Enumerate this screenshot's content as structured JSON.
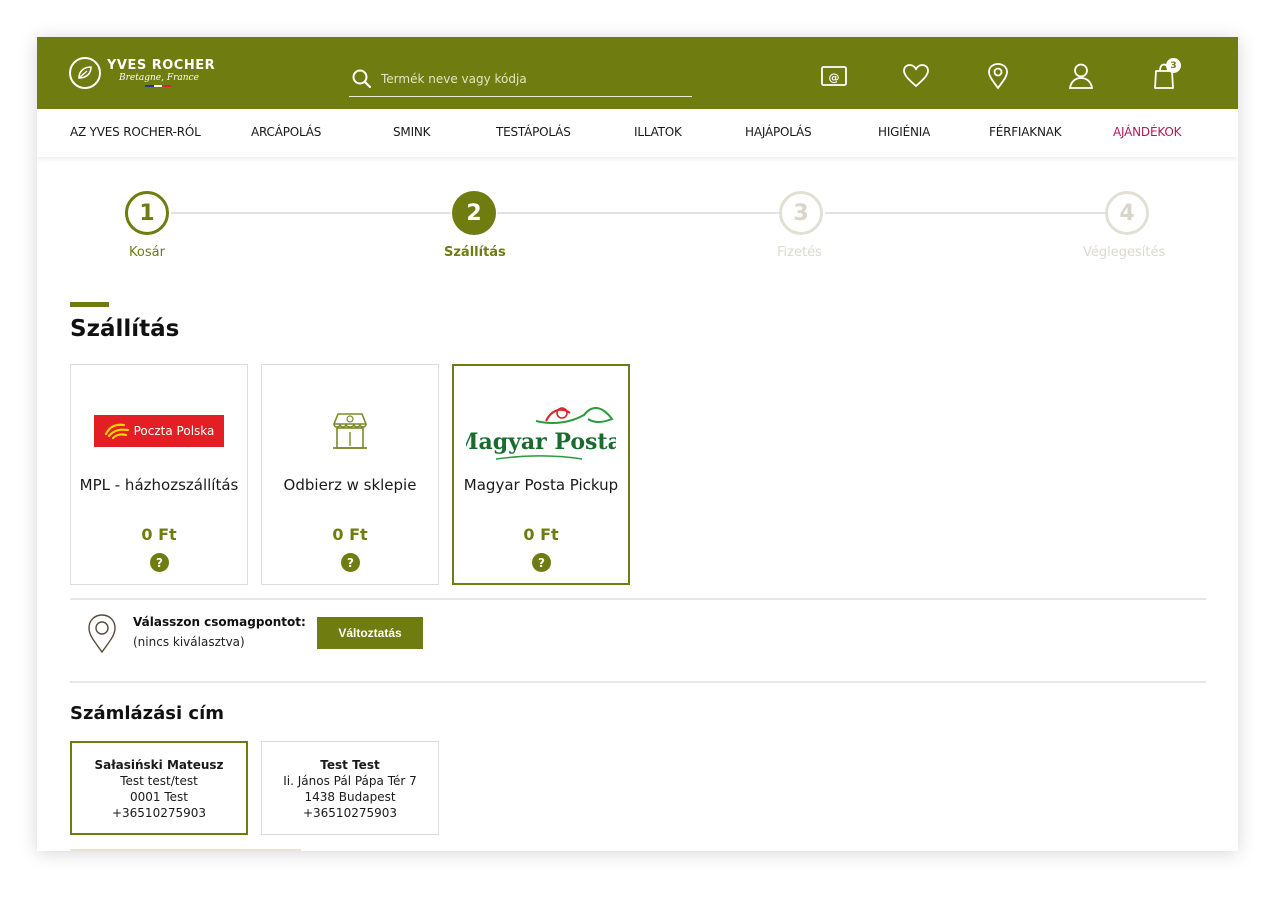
{
  "brand": {
    "name": "YVES ROCHER",
    "tagline": "Bretagne, France",
    "color": "#6f7c10",
    "flag_colors": [
      "#1f3b8f",
      "#ffffff",
      "#d8262b"
    ]
  },
  "search": {
    "placeholder": "Termék neve vagy kódja",
    "icon": "search-icon"
  },
  "header_icons": [
    {
      "name": "newsletter-icon"
    },
    {
      "name": "heart-icon"
    },
    {
      "name": "location-icon"
    },
    {
      "name": "user-icon"
    },
    {
      "name": "cart-icon",
      "badge": "3"
    }
  ],
  "nav": {
    "items": [
      "AZ YVES ROCHER-RÓL",
      "ARCÁPOLÁS",
      "SMINK",
      "TESTÁPOLÁS",
      "ILLATOK",
      "HAJÁPOLÁS",
      "HIGIÉNIA",
      "FÉRFIAKNAK",
      "AJÁNDÉKOK"
    ],
    "accent_color": "#b4195c"
  },
  "steps": [
    {
      "number": "1",
      "label": "Kosár",
      "state": "done"
    },
    {
      "number": "2",
      "label": "Szállítás",
      "state": "active"
    },
    {
      "number": "3",
      "label": "Fizetés",
      "state": "pending"
    },
    {
      "number": "4",
      "label": "Véglegesítés",
      "state": "pending"
    }
  ],
  "shipping": {
    "title": "Szállítás",
    "options": [
      {
        "name": "MPL - házhozszállítás",
        "price": "0 Ft",
        "logo_text": "Poczta Polska",
        "help": "?",
        "selected": false
      },
      {
        "name": "Odbierz w sklepie",
        "price": "0 Ft",
        "logo_text": "",
        "help": "?",
        "selected": false
      },
      {
        "name": "Magyar Posta Pickup",
        "price": "0 Ft",
        "logo_text": "Magyar Posta",
        "help": "?",
        "selected": true
      }
    ]
  },
  "pickup": {
    "title": "Válasszon csomagpontot:",
    "subtitle": "(nincs kiválasztva)",
    "button": "Változtatás"
  },
  "billing": {
    "title": "Számlázási cím",
    "addresses": [
      {
        "name": "Sałasiński Mateusz",
        "line1": "Test test/test",
        "line2": "0001 Test",
        "phone": "+36510275903",
        "selected": true
      },
      {
        "name": "Test Test",
        "line1": "Ii. János Pál Pápa Tér 7",
        "line2": "1438 Budapest",
        "phone": "+36510275903",
        "selected": false
      }
    ]
  }
}
